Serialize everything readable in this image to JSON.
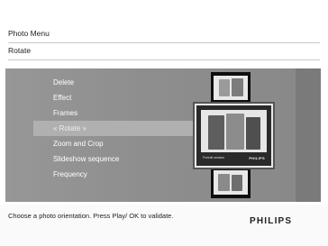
{
  "header": {
    "title": "Photo Menu",
    "subtitle": "Rotate"
  },
  "menu": {
    "items": [
      {
        "label": "Delete"
      },
      {
        "label": "Effect"
      },
      {
        "label": "Frames"
      },
      {
        "label": "« Rotate »",
        "selected": true
      },
      {
        "label": "Zoom and Crop"
      },
      {
        "label": "Slideshow sequence"
      },
      {
        "label": "Frequency"
      }
    ]
  },
  "preview": {
    "thumb_brand": "PHILIPS",
    "thumb_caption": "Portrait session"
  },
  "footer": {
    "hint": "Choose a photo orientation. Press Play/ OK to validate.",
    "brand": "PHILIPS"
  },
  "colors": {
    "panel": "#8f8f8f",
    "selected_row": "#b0b0b0",
    "film_strip": "#0e0e0e"
  }
}
